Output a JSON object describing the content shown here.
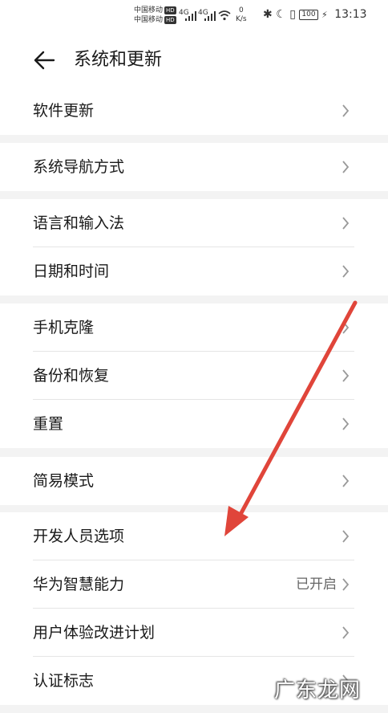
{
  "status_bar": {
    "carrier1": "中国移动",
    "carrier2": "中国移动",
    "hd": "HD",
    "net1": "4G",
    "net2": "4G",
    "speed_value": "0",
    "speed_unit": "K/s",
    "battery": "100",
    "time": "13:13"
  },
  "header": {
    "title": "系统和更新"
  },
  "groups": [
    {
      "items": [
        {
          "label": "软件更新"
        }
      ]
    },
    {
      "items": [
        {
          "label": "系统导航方式"
        }
      ]
    },
    {
      "items": [
        {
          "label": "语言和输入法"
        },
        {
          "label": "日期和时间"
        }
      ]
    },
    {
      "items": [
        {
          "label": "手机克隆"
        },
        {
          "label": "备份和恢复"
        },
        {
          "label": "重置"
        }
      ]
    },
    {
      "items": [
        {
          "label": "简易模式"
        }
      ]
    },
    {
      "items": [
        {
          "label": "开发人员选项"
        },
        {
          "label": "华为智慧能力",
          "value": "已开启"
        },
        {
          "label": "用户体验改进计划"
        },
        {
          "label": "认证标志"
        }
      ]
    }
  ],
  "watermark": "广东龙网",
  "colors": {
    "arrow": "#e0453a",
    "background": "#f3f3f3",
    "surface": "#ffffff"
  }
}
